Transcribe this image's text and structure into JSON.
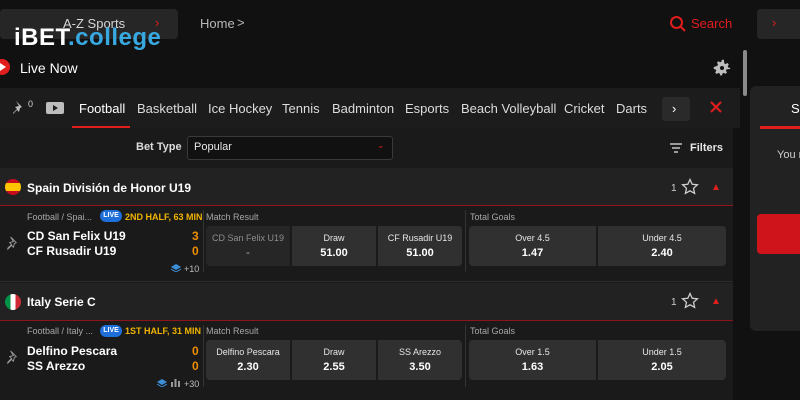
{
  "header": {
    "logo_main": "iBET",
    "logo_suffix": ".college",
    "sports_menu": "A-Z Sports",
    "breadcrumb": "Home",
    "search_label": "Search"
  },
  "live": {
    "title": "Live Now"
  },
  "tabs": {
    "pin_count": "0",
    "items": [
      "Football",
      "Basketball",
      "Ice Hockey",
      "Tennis",
      "Badminton",
      "Esports",
      "Beach Volleyball",
      "Cricket",
      "Darts"
    ],
    "active": "Football"
  },
  "filters": {
    "bet_type_label": "Bet Type",
    "bet_type_value": "Popular",
    "filters_label": "Filters"
  },
  "side": {
    "tab_partial": "S",
    "text_partial": "You r"
  },
  "leagues": [
    {
      "name": "Spain División de Honor U19",
      "count": "1",
      "match": {
        "meta": "Football / Spai...",
        "live_badge": "LIVE",
        "status": "2ND HALF, 63 MIN",
        "home": "CD San Felix U19",
        "away": "CF Rusadir U19",
        "home_score": "3",
        "away_score": "0",
        "more_markets": "+10",
        "market1_label": "Match Result",
        "market2_label": "Total Goals",
        "odds": [
          {
            "name": "CD San Felix U19",
            "value": "-"
          },
          {
            "name": "Draw",
            "value": "51.00"
          },
          {
            "name": "CF Rusadir U19",
            "value": "51.00"
          },
          {
            "name": "Over 4.5",
            "value": "1.47"
          },
          {
            "name": "Under 4.5",
            "value": "2.40"
          }
        ]
      }
    },
    {
      "name": "Italy Serie C",
      "count": "1",
      "match": {
        "meta": "Football / Italy ...",
        "live_badge": "LIVE",
        "status": "1ST HALF, 31 MIN",
        "home": "Delfino Pescara",
        "away": "SS Arezzo",
        "home_score": "0",
        "away_score": "0",
        "more_markets": "+30",
        "market1_label": "Match Result",
        "market2_label": "Total Goals",
        "odds": [
          {
            "name": "Delfino Pescara",
            "value": "2.30"
          },
          {
            "name": "Draw",
            "value": "2.55"
          },
          {
            "name": "SS Arezzo",
            "value": "3.50"
          },
          {
            "name": "Over 1.5",
            "value": "1.63"
          },
          {
            "name": "Under 1.5",
            "value": "2.05"
          }
        ]
      }
    }
  ],
  "colors": {
    "accent": "#e11d1d",
    "logo_suffix": "#38a8e0",
    "score": "#f08c00",
    "status": "#f0b400",
    "live_badge": "#1e6fd9"
  }
}
